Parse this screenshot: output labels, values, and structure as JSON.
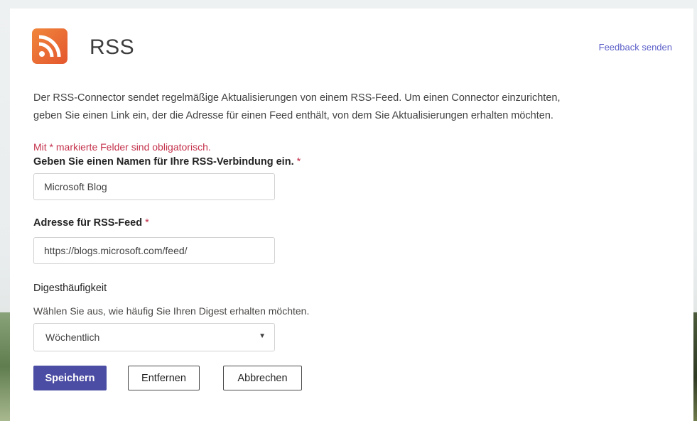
{
  "header": {
    "title": "RSS",
    "feedback_label": "Feedback senden",
    "logo_icon": "rss-icon",
    "logo_color": "#e4572e"
  },
  "description": {
    "line1": "Der RSS-Connector sendet regelmäßige Aktualisierungen von einem RSS-Feed. Um einen Connector einzurichten,",
    "line2": "geben Sie einen Link ein, der die Adresse für einen Feed enthält, von dem Sie Aktualisierungen erhalten möchten."
  },
  "form": {
    "required_note": "Mit * markierte Felder sind obligatorisch.",
    "name_field": {
      "label": "Geben Sie einen Namen für Ihre RSS-Verbindung ein.",
      "required_mark": "*",
      "value": "Microsoft Blog"
    },
    "feed_field": {
      "label": "Adresse für RSS-Feed",
      "required_mark": "*",
      "value": "https://blogs.microsoft.com/feed/"
    },
    "digest": {
      "label": "Digesthäufigkeit",
      "hint": "Wählen Sie aus, wie häufig Sie Ihren Digest erhalten möchten.",
      "selected": "Wöchentlich",
      "caret": "▼"
    }
  },
  "buttons": {
    "save": "Speichern",
    "remove": "Entfernen",
    "cancel": "Abbrechen"
  },
  "colors": {
    "primary": "#4b4ca3",
    "required": "#c4314b",
    "link": "#5b5fc7"
  }
}
